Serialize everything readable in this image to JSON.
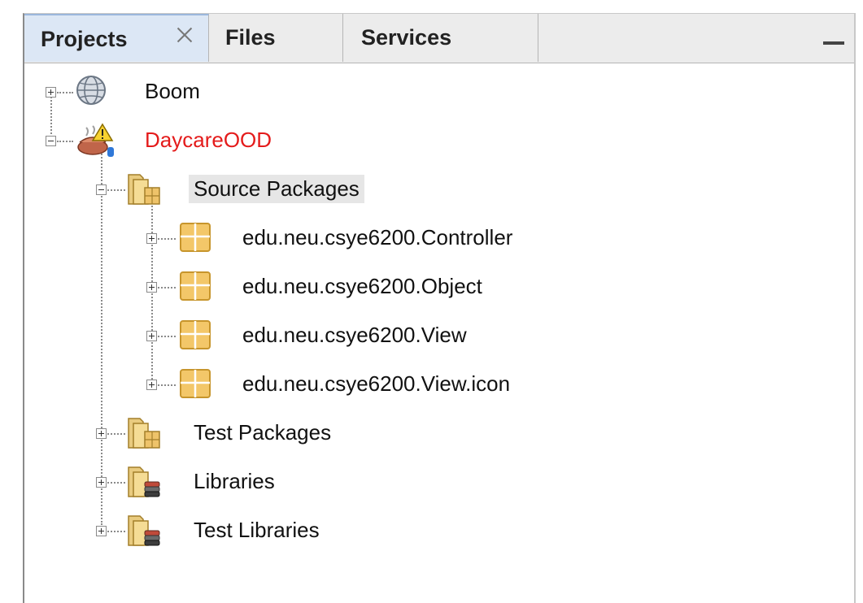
{
  "tabs": [
    {
      "label": "Projects",
      "active": true,
      "closable": true
    },
    {
      "label": "Files",
      "active": false
    },
    {
      "label": "Services",
      "active": false
    }
  ],
  "tree": {
    "projects": [
      {
        "label": "Boom",
        "icon": "web-project-icon",
        "expanded": false
      },
      {
        "label": "DaycareOOD",
        "icon": "java-project-warning-icon",
        "expanded": true,
        "error": true,
        "error_color": "#e41b1b"
      }
    ],
    "daycare_children": [
      {
        "label": "Source Packages",
        "icon": "source-folder-icon",
        "expanded": true,
        "selected": true
      },
      {
        "label": "Test Packages",
        "icon": "source-folder-icon",
        "expanded": false
      },
      {
        "label": "Libraries",
        "icon": "library-folder-icon",
        "expanded": false
      },
      {
        "label": "Test Libraries",
        "icon": "library-folder-icon",
        "expanded": false
      }
    ],
    "packages": [
      {
        "label": "edu.neu.csye6200.Controller",
        "icon": "package-icon"
      },
      {
        "label": "edu.neu.csye6200.Object",
        "icon": "package-icon"
      },
      {
        "label": "edu.neu.csye6200.View",
        "icon": "package-icon"
      },
      {
        "label": "edu.neu.csye6200.View.icon",
        "icon": "package-icon"
      }
    ]
  }
}
